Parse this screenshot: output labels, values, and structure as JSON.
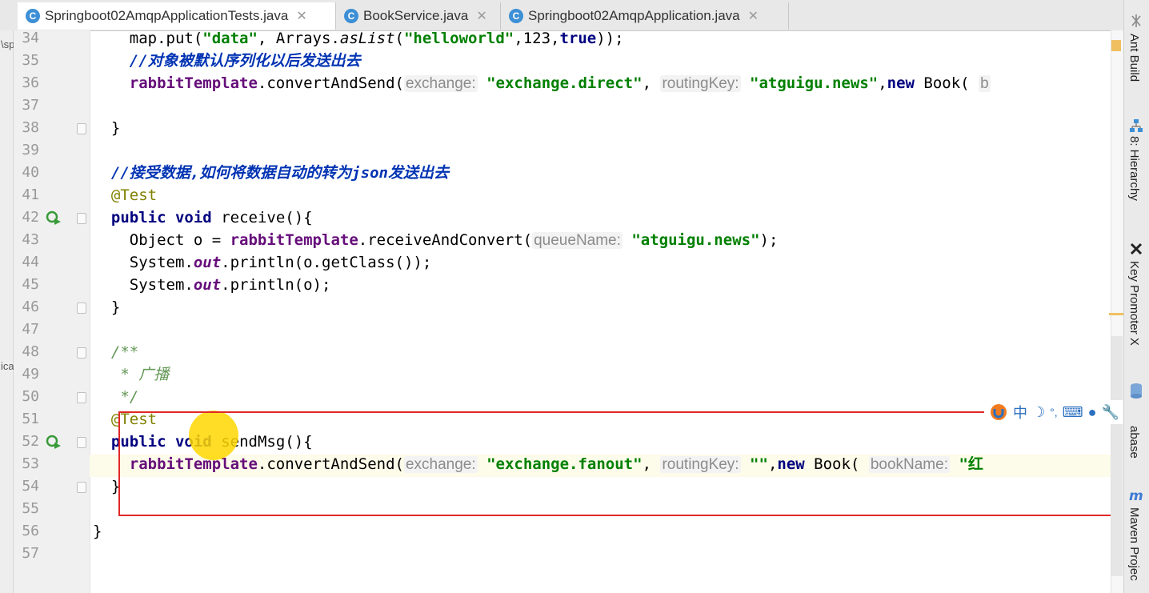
{
  "tabs": [
    {
      "label": "Springboot02AmqpApplicationTests.java",
      "icon": "test-class-icon",
      "active": true
    },
    {
      "label": "BookService.java",
      "icon": "class-icon",
      "active": false
    },
    {
      "label": "Springboot02AmqpApplication.java",
      "icon": "app-class-icon",
      "active": false
    }
  ],
  "left_strip": {
    "top_text": "\\sp",
    "mid_text": "ica"
  },
  "line_numbers": [
    "34",
    "35",
    "36",
    "37",
    "38",
    "39",
    "40",
    "41",
    "42",
    "43",
    "44",
    "45",
    "46",
    "47",
    "48",
    "49",
    "50",
    "51",
    "52",
    "53",
    "54",
    "55",
    "56",
    "57"
  ],
  "code": {
    "l34_a": "map.put(",
    "l34_s1": "\"data\"",
    "l34_b": ", Arrays.",
    "l34_c": "asList",
    "l34_d": "(",
    "l34_s2": "\"helloworld\"",
    "l34_e": ",123,",
    "l34_kw": "true",
    "l34_f": "));",
    "l35": "//对象被默认序列化以后发送出去",
    "l36_fld": "rabbitTemplate",
    "l36_a": ".convertAndSend(",
    "l36_h1": "exchange:",
    "l36_s1": "\"exchange.direct\"",
    "l36_b": ",",
    "l36_h2": "routingKey:",
    "l36_s2": "\"atguigu.news\"",
    "l36_c": ",",
    "l36_kw": "new",
    "l36_d": " Book(",
    "l36_h3": "b",
    "l38": "}",
    "l40_a": "//接受数据,如何将数据自动的转为",
    "l40_b": "json",
    "l40_c": "发送出去",
    "l41": "@Test",
    "l42_kw1": "public",
    "l42_kw2": "void",
    "l42_a": " receive(){",
    "l43_a": "Object o = ",
    "l43_fld": "rabbitTemplate",
    "l43_b": ".receiveAndConvert(",
    "l43_h": "queueName:",
    "l43_s": "\"atguigu.news\"",
    "l43_c": ");",
    "l44_a": "System.",
    "l44_out": "out",
    "l44_b": ".println(o.getClass());",
    "l45_a": "System.",
    "l45_out": "out",
    "l45_b": ".println(o);",
    "l46": "}",
    "l48": "/**",
    "l49": " * 广播",
    "l50": " */",
    "l51": "@Test",
    "l52_kw1": "public",
    "l52_kw2": "void",
    "l52_a": " sendMsg(){",
    "l53_fld": "rabbitTemplate",
    "l53_a": ".convertAndSend(",
    "l53_h1": "exchange:",
    "l53_s1": "\"exchange.fanout\"",
    "l53_b": ",",
    "l53_h2": "routingKey:",
    "l53_s2": "\"\"",
    "l53_c": ",",
    "l53_kw": "new",
    "l53_d": " Book(",
    "l53_h3": "bookName:",
    "l53_s3": "\"红",
    "l54": "}",
    "l56": "}"
  },
  "right_tools": [
    {
      "label": "Ant Build",
      "icon": "ant-icon"
    },
    {
      "label": "8: Hierarchy",
      "icon": "hierarchy-icon"
    },
    {
      "label": "Key Promoter X",
      "icon": "key-promoter-icon"
    },
    {
      "label": "abase",
      "icon": "database-icon"
    },
    {
      "label": "Maven Projec",
      "icon": "maven-icon"
    }
  ],
  "ime": {
    "lang": "中",
    "icons": [
      "ime-logo-icon",
      "moon-icon",
      "question-icon",
      "keyboard-icon",
      "user-icon",
      "wrench-icon"
    ]
  },
  "colors": {
    "keyword": "#000080",
    "string": "#008000",
    "field": "#660e7a",
    "comment": "#0033b3",
    "annotation": "#808000",
    "highlight_box": "#e02828"
  }
}
